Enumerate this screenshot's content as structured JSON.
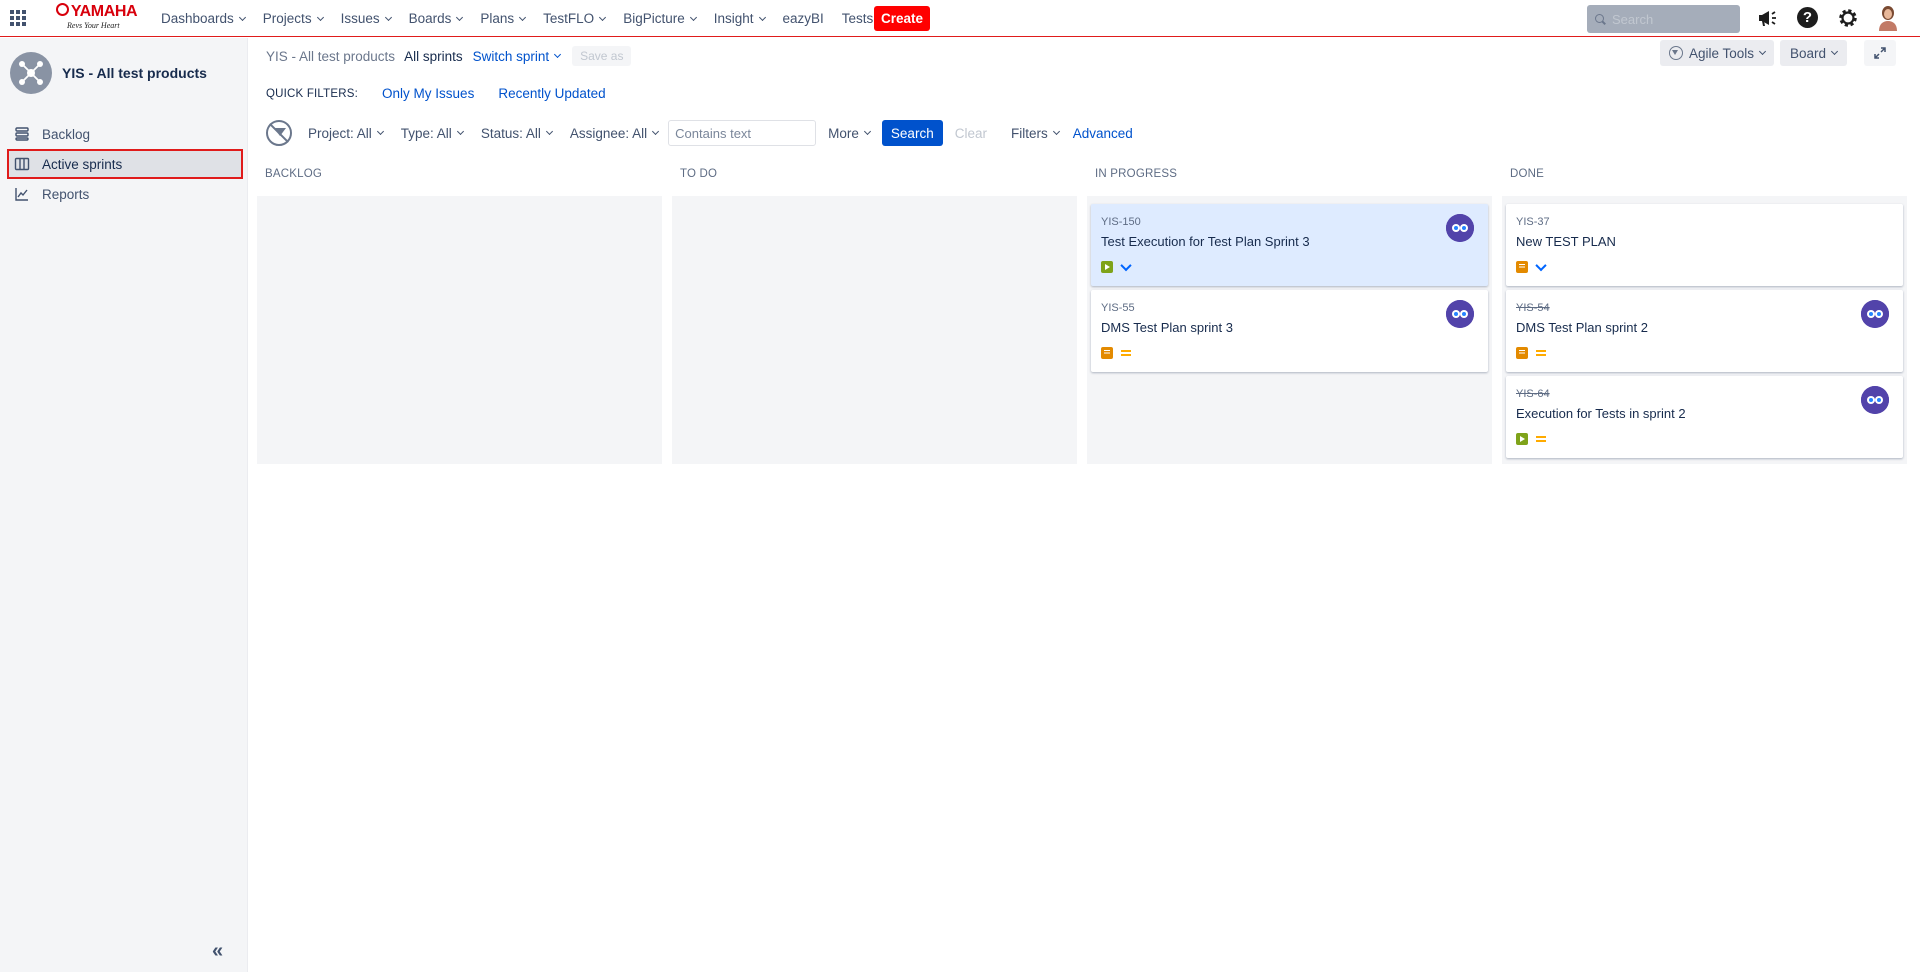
{
  "topnav": {
    "logo_text": "YAMAHA",
    "logo_tagline": "Revs Your Heart",
    "menu": [
      {
        "label": "Dashboards",
        "dropdown": true
      },
      {
        "label": "Projects",
        "dropdown": true
      },
      {
        "label": "Issues",
        "dropdown": true
      },
      {
        "label": "Boards",
        "dropdown": true
      },
      {
        "label": "Plans",
        "dropdown": true
      },
      {
        "label": "TestFLO",
        "dropdown": true
      },
      {
        "label": "BigPicture",
        "dropdown": true
      },
      {
        "label": "Insight",
        "dropdown": true
      },
      {
        "label": "eazyBI",
        "dropdown": false
      },
      {
        "label": "Tests",
        "dropdown": true
      }
    ],
    "create_label": "Create",
    "search_placeholder": "Search",
    "icons": [
      "apps-grid-icon",
      "megaphone-icon",
      "help-icon",
      "settings-gear-icon",
      "user-avatar"
    ]
  },
  "sidebar": {
    "project_title": "YIS - All test products",
    "items": [
      {
        "label": "Backlog",
        "icon": "backlog-icon",
        "active": false
      },
      {
        "label": "Active sprints",
        "icon": "board-columns-icon",
        "active": true
      },
      {
        "label": "Reports",
        "icon": "chart-line-icon",
        "active": false
      }
    ],
    "collapse_glyph": "«"
  },
  "header": {
    "project": "YIS - All test products",
    "sprint_scope": "All sprints",
    "switch_sprint": "Switch sprint",
    "save_as": "Save as",
    "agile_tools": "Agile Tools",
    "board": "Board"
  },
  "quick_filters": {
    "label": "QUICK FILTERS:",
    "links": [
      "Only My Issues",
      "Recently Updated"
    ]
  },
  "filterbar": {
    "dropdowns": [
      "Project: All",
      "Type: All",
      "Status: All",
      "Assignee: All"
    ],
    "text_placeholder": "Contains text",
    "more": "More",
    "search": "Search",
    "clear": "Clear",
    "filters": "Filters",
    "advanced": "Advanced"
  },
  "columns": [
    {
      "name": "BACKLOG",
      "cards": []
    },
    {
      "name": "TO DO",
      "cards": []
    },
    {
      "name": "IN PROGRESS",
      "cards": [
        {
          "key": "YIS-150",
          "summary": "Test Execution for Test Plan Sprint 3",
          "type": "test-execution",
          "priority": "low",
          "selected": true,
          "resolved": false,
          "has_assignee": true
        },
        {
          "key": "YIS-55",
          "summary": "DMS Test Plan sprint 3",
          "type": "test-plan",
          "priority": "medium",
          "selected": false,
          "resolved": false,
          "has_assignee": true
        }
      ]
    },
    {
      "name": "DONE",
      "cards": [
        {
          "key": "YIS-37",
          "summary": "New TEST PLAN",
          "type": "test-plan",
          "priority": "low",
          "selected": false,
          "resolved": false,
          "has_assignee": false
        },
        {
          "key": "YIS-54",
          "summary": "DMS Test Plan sprint 2",
          "type": "test-plan",
          "priority": "medium",
          "selected": false,
          "resolved": true,
          "has_assignee": true
        },
        {
          "key": "YIS-64",
          "summary": "Execution for Tests in sprint 2",
          "type": "test-execution",
          "priority": "medium",
          "selected": false,
          "resolved": true,
          "has_assignee": true
        }
      ]
    }
  ],
  "colors": {
    "accent_blue": "#0052cc",
    "create_red": "#ff0000",
    "highlight_red": "#e01b1b",
    "selected_card": "#deebff",
    "column_bg": "#f4f5f7"
  }
}
